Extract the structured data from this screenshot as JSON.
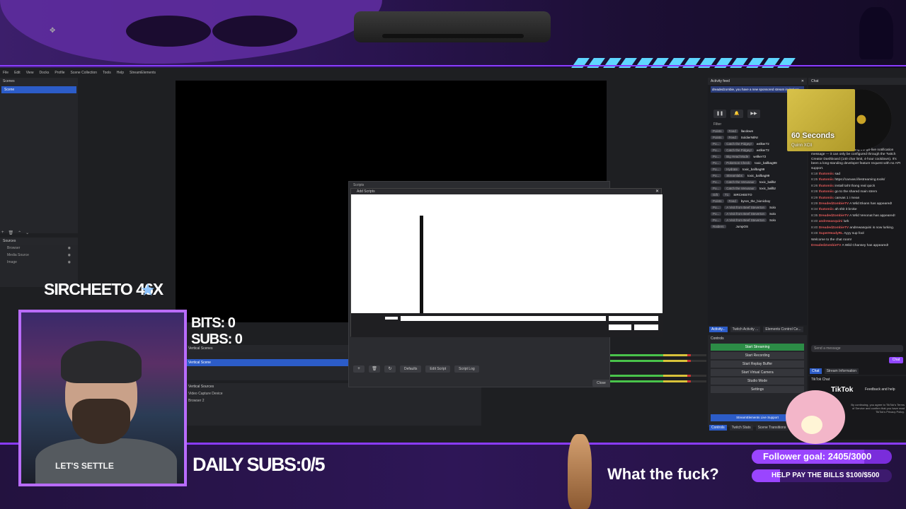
{
  "obs": {
    "menu": [
      "File",
      "Edit",
      "View",
      "Docks",
      "Profile",
      "Scene Collection",
      "Tools",
      "Help",
      "StreamElements"
    ],
    "scenes_title": "Scenes",
    "scene_selected": "Scene",
    "sources_title": "Sources",
    "sources": [
      "Browser",
      "Media Source",
      "Image"
    ],
    "vertical_scenes_title": "Vertical Scenes",
    "vertical_scene_selected": "Vertical Scene",
    "vertical_sources_title": "Vertical Sources",
    "vertical_sources": [
      "Video Capture Device",
      "Browser 2"
    ]
  },
  "scripts_dialog": {
    "title": "Scripts",
    "buttons": [
      "Defaults",
      "Edit Script",
      "Script Log"
    ],
    "close_label": "Close",
    "add_dialog_title": "Add Scripts"
  },
  "activity_feed": {
    "title": "Activity feed",
    "banner": "dreadedzombie, you have a new sponsored stream invitation!",
    "filter_label": "Filter",
    "rows": [
      {
        "tag": "Points",
        "tag2": "Feed",
        "name": "llacdown"
      },
      {
        "tag": "Points",
        "tag2": "Feed",
        "name": "SoldierNIlNI"
      },
      {
        "tag": "Po...",
        "tag2": "Catch the Pidgey!",
        "name": "w4lker72"
      },
      {
        "tag": "Po...",
        "tag2": "Catch the Pidgey!",
        "name": "w4lker72"
      },
      {
        "tag": "Po...",
        "tag2": "Big Head Mode",
        "name": "w4lker72"
      },
      {
        "tag": "Po...",
        "tag2": "Pokemon Check",
        "name": "toxic_ballbag99"
      },
      {
        "tag": "Po...",
        "tag2": "Hydrate",
        "name": "toxic_ballbag99"
      },
      {
        "tag": "Po...",
        "tag2": "Streamlabs",
        "name": "toxic_ballbag99"
      },
      {
        "tag": "Po...",
        "tag2": "Catch the Venusaur",
        "name": "toxic_ballbz"
      },
      {
        "tag": "Po...",
        "tag2": "Catch the Venusaur",
        "name": "toxic_ballbz"
      },
      {
        "tag": "Gift",
        "tag2": "T1",
        "name": "SIRCHEETO"
      },
      {
        "tag": "Points",
        "tag2": "Feed",
        "name": "byron_the_bionicboy"
      },
      {
        "tag": "Po...",
        "tag2": "A Visit from Beef Steverton",
        "name": "Solo"
      },
      {
        "tag": "Po...",
        "tag2": "A Visit from Beef Steverton",
        "name": "Solo"
      },
      {
        "tag": "Po...",
        "tag2": "A Visit from Beef Steverton",
        "name": "Solo"
      },
      {
        "tag": "Raiders",
        "tag2": "",
        "name": "JumpOS"
      }
    ],
    "tabs": [
      "Activity...",
      "Twitch Activity ...",
      "Elements Control Ce..."
    ]
  },
  "controls": {
    "title": "Controls",
    "buttons": [
      "Start Streaming",
      "Start Recording",
      "Start Replay Buffer",
      "Start Virtual Camera",
      "Studio Mode",
      "Settings"
    ],
    "live_support": "StreamElements Live Support",
    "tabs": [
      "Controls",
      "Twitch Stats",
      "Scene Transitions"
    ]
  },
  "chat": {
    "title": "Chat",
    "messages": [
      {
        "time": "",
        "user": "",
        "text": "There's no Twitch API for setting the go-live notification message — it can only be configured through the Twitch Creator Dashboard (140 char limit, 4-hour cooldown). It's been a long-standing developer feature request with no API support."
      },
      {
        "time": "8:18",
        "user": "thatomiic",
        "text": "sad"
      },
      {
        "time": "8:25",
        "user": "thatomiic",
        "text": "https://canvas.lifestreaming.tools/"
      },
      {
        "time": "8:26",
        "user": "thatomiic",
        "text": "install taht thang real quick"
      },
      {
        "time": "8:28",
        "user": "thatomiic",
        "text": "go to the shared main strem"
      },
      {
        "time": "8:29",
        "user": "thatomiic",
        "text": "canvas 1 i mean"
      },
      {
        "time": "8:29",
        "user": "DreadedZombieTV",
        "text": "A Wild Ekans has appeared!"
      },
      {
        "time": "8:34",
        "user": "thatomiic",
        "text": "ah shit it broke"
      },
      {
        "time": "8:35",
        "user": "DreadedZombieTV",
        "text": "A Wild Venonat has appeared!"
      },
      {
        "time": "8:40",
        "user": "andrewasquini",
        "text": "lurk"
      },
      {
        "time": "8:40",
        "user": "DreadedZombieTV",
        "text": "andrewasquini is now lurking."
      },
      {
        "time": "8:48",
        "user": "SuperHeadyRL",
        "text": "Ayyy sup fool"
      },
      {
        "time": "",
        "user": "",
        "text": "Welcome to the chat room!"
      },
      {
        "time": "",
        "user": "DreadedZombieTV",
        "text": "A Wild Chansey has appeared!"
      }
    ],
    "input_placeholder": "Send a message",
    "send_label": "Chat",
    "tabs": [
      "Chat",
      "Stream Information"
    ],
    "tiktok_title": "TikTok Chat",
    "tiktok_logo": "TikTok",
    "tiktok_help": "Feedback and help",
    "tiktok_terms": "By continuing, you agree to TikTok's Terms of Service and confirm that you have read TikTok's Privacy Policy."
  },
  "now_playing": {
    "title": "60 Seconds",
    "artist": "Quinn XCII"
  },
  "overlay": {
    "streamer_name": "SIRCHEETO",
    "streamer_badge": "46X",
    "bits": "BITS: 0",
    "subs": "SUBS: 0",
    "daily_subs": "DAILY SUBS:0/5",
    "caption": "What the fuck?",
    "shirt_text": "LET'S SETTLE",
    "follower_goal": "Follower goal:  2405/3000",
    "follower_progress": 0.8017,
    "bills_goal": "HELP PAY THE BILLS  $100/$500",
    "bills_progress": 0.2
  },
  "colors": {
    "accent": "#8a3cff",
    "obs_blue": "#2c5cc8",
    "stream_green": "#2c8c46",
    "stripe_cyan": "#5fd6ff"
  }
}
